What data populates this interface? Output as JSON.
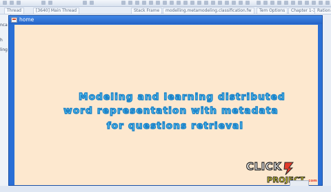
{
  "ide": {
    "tabs": [
      "Thread",
      "[3640] Main Thread",
      "Stack Frame",
      "modelling.metamodeling.classification.fw",
      "Tem Options",
      "Chapter 1-3",
      "Ration"
    ],
    "sidebar_texts": [
      "nca",
      "h",
      "ling"
    ]
  },
  "window": {
    "title": "home"
  },
  "headline": {
    "line1": "Modeling and learning distributed",
    "line2": "word representation with metadata",
    "line3": "for questions retrieval"
  },
  "logo": {
    "word1": "CLICK",
    "word2": "PROJECT",
    "suffix": ".com",
    "colors": {
      "click": "#f7f7f7",
      "project": "#f5ea28",
      "bolt": "#e23b2b"
    }
  },
  "colors": {
    "accent": "#2a6fd6",
    "canvas": "#fde8cf",
    "headline_fill": "#5ec8f2",
    "headline_stroke": "#1c82c8"
  }
}
